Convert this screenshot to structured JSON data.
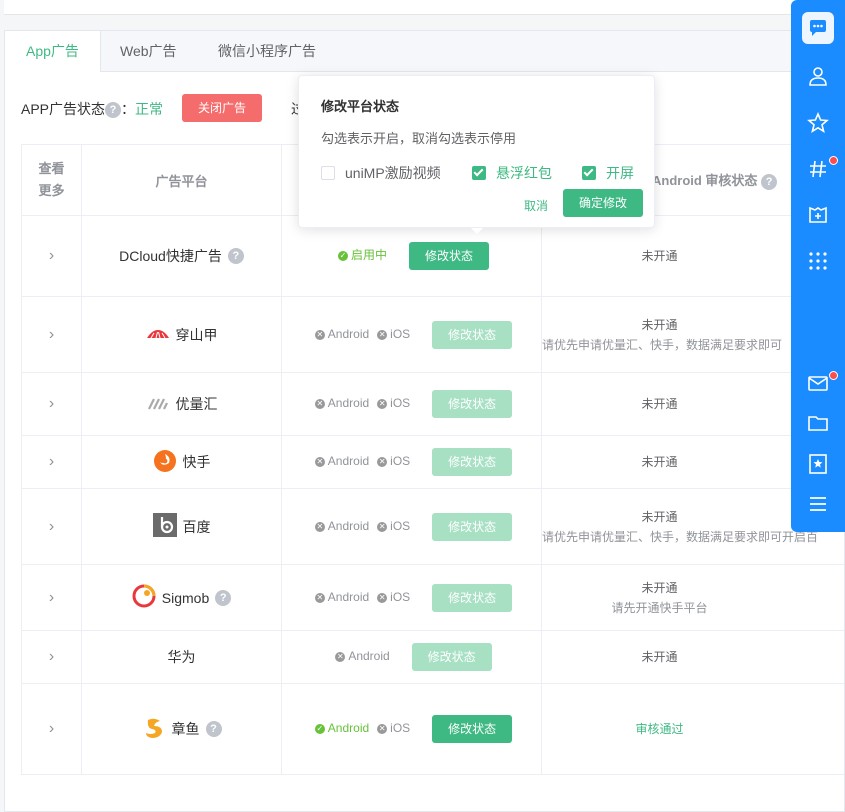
{
  "tabs": [
    "App广告",
    "Web广告",
    "微信小程序广告"
  ],
  "status": {
    "label": "APP广告状态",
    "colon": "：",
    "value": "正常",
    "close_button": "关闭广告",
    "partial_char": "过"
  },
  "table": {
    "headers": {
      "col1": [
        "查看",
        "更多"
      ],
      "col2": "广告平台",
      "col4": "Android 审核状态"
    },
    "rows": [
      {
        "name": "DCloud快捷广告",
        "help": true,
        "chips": [
          {
            "label": "启用中",
            "on": true
          }
        ],
        "btn": "修改状态",
        "btn_enabled": true,
        "audit": [
          "未开通"
        ],
        "logo": "none"
      },
      {
        "name": "穿山甲",
        "chips": [
          {
            "label": "Android"
          },
          {
            "label": "iOS"
          }
        ],
        "btn": "修改状态",
        "btn_enabled": false,
        "audit": [
          "未开通",
          "请优先申请优量汇、快手，数据满足要求即可"
        ],
        "logo": "pangle"
      },
      {
        "name": "优量汇",
        "chips": [
          {
            "label": "Android"
          },
          {
            "label": "iOS"
          }
        ],
        "btn": "修改状态",
        "btn_enabled": false,
        "audit": [
          "未开通"
        ],
        "logo": "gdt"
      },
      {
        "name": "快手",
        "chips": [
          {
            "label": "Android"
          },
          {
            "label": "iOS"
          }
        ],
        "btn": "修改状态",
        "btn_enabled": false,
        "audit": [
          "未开通"
        ],
        "logo": "kuaishou"
      },
      {
        "name": "百度",
        "chips": [
          {
            "label": "Android"
          },
          {
            "label": "iOS"
          }
        ],
        "btn": "修改状态",
        "btn_enabled": false,
        "audit": [
          "未开通",
          "请优先申请优量汇、快手，数据满足要求即可开启百"
        ],
        "logo": "baidu"
      },
      {
        "name": "Sigmob",
        "help": true,
        "chips": [
          {
            "label": "Android"
          },
          {
            "label": "iOS"
          }
        ],
        "btn": "修改状态",
        "btn_enabled": false,
        "audit": [
          "未开通",
          "请先开通快手平台"
        ],
        "logo": "sigmob"
      },
      {
        "name": "华为",
        "chips": [
          {
            "label": "Android"
          }
        ],
        "btn": "修改状态",
        "btn_enabled": false,
        "audit": [
          "未开通"
        ],
        "logo": "none"
      },
      {
        "name": "章鱼",
        "help": true,
        "chips": [
          {
            "label": "Android",
            "on": true
          },
          {
            "label": "iOS"
          }
        ],
        "btn": "修改状态",
        "btn_enabled": true,
        "audit": [
          "审核通过"
        ],
        "audit_ok": true,
        "logo": "octopus"
      }
    ]
  },
  "popover": {
    "title": "修改平台状态",
    "desc": "勾选表示开启，取消勾选表示停用",
    "options": [
      {
        "label": "uniMP激励视频",
        "checked": false
      },
      {
        "label": "悬浮红包",
        "checked": true
      },
      {
        "label": "开屏",
        "checked": true
      }
    ],
    "cancel": "取消",
    "confirm": "确定修改"
  },
  "rail_icons": [
    "chat-icon",
    "user-icon",
    "star-icon",
    "hashtag-icon",
    "game-icon",
    "apps-grid-icon",
    "mail-icon",
    "folder-icon",
    "bookmark-icon",
    "menu-icon"
  ],
  "colors": {
    "brand": "#3fb984",
    "danger": "#f56c6c",
    "rail": "#1a8cff"
  }
}
